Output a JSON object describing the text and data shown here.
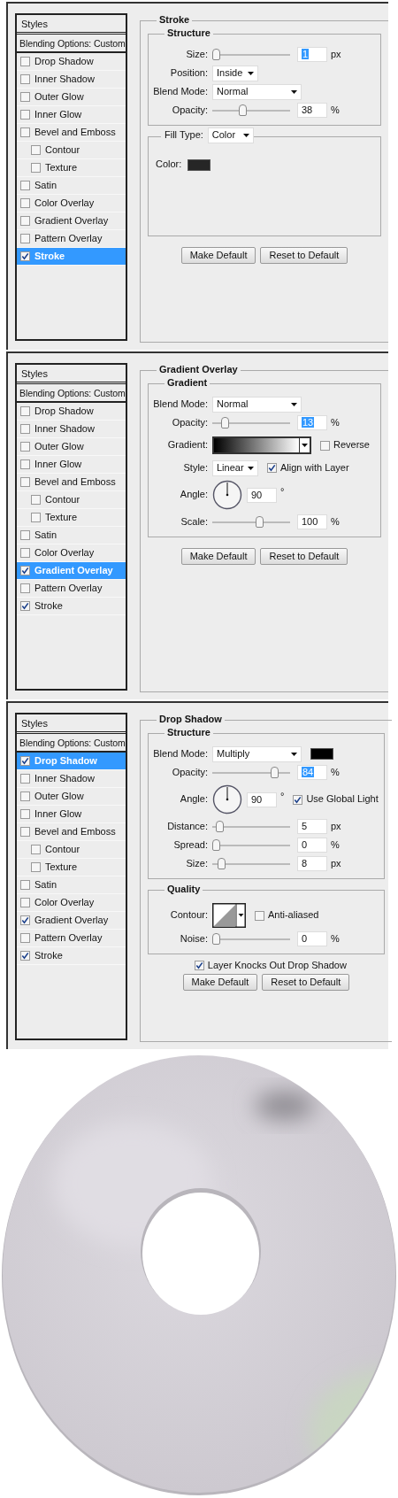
{
  "panels": [
    {
      "header": "Styles",
      "blending": "Blending Options: Custom",
      "effects": [
        {
          "label": "Drop Shadow",
          "checked": false,
          "selected": false
        },
        {
          "label": "Inner Shadow",
          "checked": false,
          "selected": false
        },
        {
          "label": "Outer Glow",
          "checked": false,
          "selected": false
        },
        {
          "label": "Inner Glow",
          "checked": false,
          "selected": false
        },
        {
          "label": "Bevel and Emboss",
          "checked": false,
          "selected": false,
          "children": [
            {
              "label": "Contour",
              "checked": false,
              "selected": false
            },
            {
              "label": "Texture",
              "checked": false,
              "selected": false
            }
          ]
        },
        {
          "label": "Satin",
          "checked": false,
          "selected": false
        },
        {
          "label": "Color Overlay",
          "checked": false,
          "selected": false
        },
        {
          "label": "Gradient Overlay",
          "checked": false,
          "selected": false
        },
        {
          "label": "Pattern Overlay",
          "checked": false,
          "selected": false
        },
        {
          "label": "Stroke",
          "checked": true,
          "selected": true
        }
      ],
      "title": "Stroke",
      "groups": [
        {
          "title": "Structure",
          "rows": [
            {
              "kind": "slider",
              "label": "Size:",
              "level": 0,
              "value": "1",
              "unit": "px",
              "highlighted": true
            },
            {
              "kind": "select",
              "label": "Position:",
              "value": "Inside",
              "wide": false
            },
            {
              "kind": "select",
              "label": "Blend Mode:",
              "value": "Normal",
              "wide": true
            },
            {
              "kind": "slider",
              "label": "Opacity:",
              "level": 0.38,
              "value": "38",
              "unit": "%",
              "highlighted": false
            }
          ]
        },
        {
          "legend": {
            "label": "Fill Type:",
            "value": "Color"
          },
          "rows": [
            {
              "kind": "color",
              "label": "Color:",
              "color": "#262626"
            }
          ]
        }
      ],
      "buttons": [
        "Make Default",
        "Reset to Default"
      ]
    },
    {
      "header": "Styles",
      "blending": "Blending Options: Custom",
      "effects": [
        {
          "label": "Drop Shadow",
          "checked": false,
          "selected": false
        },
        {
          "label": "Inner Shadow",
          "checked": false,
          "selected": false
        },
        {
          "label": "Outer Glow",
          "checked": false,
          "selected": false
        },
        {
          "label": "Inner Glow",
          "checked": false,
          "selected": false
        },
        {
          "label": "Bevel and Emboss",
          "checked": false,
          "selected": false,
          "children": [
            {
              "label": "Contour",
              "checked": false,
              "selected": false
            },
            {
              "label": "Texture",
              "checked": false,
              "selected": false
            }
          ]
        },
        {
          "label": "Satin",
          "checked": false,
          "selected": false
        },
        {
          "label": "Color Overlay",
          "checked": false,
          "selected": false
        },
        {
          "label": "Gradient Overlay",
          "checked": true,
          "selected": true
        },
        {
          "label": "Pattern Overlay",
          "checked": false,
          "selected": false
        },
        {
          "label": "Stroke",
          "checked": true,
          "selected": false
        }
      ],
      "title": "Gradient Overlay",
      "groups": [
        {
          "title": "Gradient",
          "rows": [
            {
              "kind": "select",
              "label": "Blend Mode:",
              "value": "Normal",
              "wide": true
            },
            {
              "kind": "slider",
              "label": "Opacity:",
              "level": 0.13,
              "value": "13",
              "unit": "%",
              "highlighted": true
            },
            {
              "kind": "gradient",
              "label": "Gradient:",
              "check": {
                "label": "Reverse",
                "checked": false
              }
            },
            {
              "kind": "select",
              "label": "Style:",
              "value": "Linear",
              "wide": false,
              "check": {
                "label": "Align with Layer",
                "checked": true
              }
            },
            {
              "kind": "angle",
              "label": "Angle:",
              "value": "90",
              "unit": "°"
            },
            {
              "kind": "slider",
              "label": "Scale:",
              "level": 0.62,
              "value": "100",
              "unit": "%",
              "highlighted": false
            }
          ]
        }
      ],
      "buttons": [
        "Make Default",
        "Reset to Default"
      ]
    },
    {
      "header": "Styles",
      "blending": "Blending Options: Custom",
      "effects": [
        {
          "label": "Drop Shadow",
          "checked": true,
          "selected": true
        },
        {
          "label": "Inner Shadow",
          "checked": false,
          "selected": false
        },
        {
          "label": "Outer Glow",
          "checked": false,
          "selected": false
        },
        {
          "label": "Inner Glow",
          "checked": false,
          "selected": false
        },
        {
          "label": "Bevel and Emboss",
          "checked": false,
          "selected": false,
          "children": [
            {
              "label": "Contour",
              "checked": false,
              "selected": false
            },
            {
              "label": "Texture",
              "checked": false,
              "selected": false
            }
          ]
        },
        {
          "label": "Satin",
          "checked": false,
          "selected": false
        },
        {
          "label": "Color Overlay",
          "checked": false,
          "selected": false
        },
        {
          "label": "Gradient Overlay",
          "checked": true,
          "selected": false
        },
        {
          "label": "Pattern Overlay",
          "checked": false,
          "selected": false
        },
        {
          "label": "Stroke",
          "checked": true,
          "selected": false
        }
      ],
      "title": "Drop Shadow",
      "groups": [
        {
          "title": "Structure",
          "rows": [
            {
              "kind": "select",
              "label": "Blend Mode:",
              "value": "Multiply",
              "wide": true,
              "color": "#000000"
            },
            {
              "kind": "slider",
              "label": "Opacity:",
              "level": 0.84,
              "value": "84",
              "unit": "%",
              "highlighted": true
            },
            {
              "kind": "angle",
              "label": "Angle:",
              "value": "90",
              "unit": "°",
              "check": {
                "label": "Use Global Light",
                "checked": true
              }
            },
            {
              "kind": "slider",
              "label": "Distance:",
              "level": 0.05,
              "value": "5",
              "unit": "px",
              "highlighted": false
            },
            {
              "kind": "slider",
              "label": "Spread:",
              "level": 0,
              "value": "0",
              "unit": "%",
              "highlighted": false
            },
            {
              "kind": "slider",
              "label": "Size:",
              "level": 0.08,
              "value": "8",
              "unit": "px",
              "highlighted": false
            }
          ]
        },
        {
          "title": "Quality",
          "rows": [
            {
              "kind": "contour",
              "label": "Contour:",
              "check": {
                "label": "Anti-aliased",
                "checked": false
              }
            },
            {
              "kind": "slider",
              "label": "Noise:",
              "level": 0,
              "value": "0",
              "unit": "%",
              "highlighted": false
            }
          ]
        }
      ],
      "footer_check": {
        "label": "Layer Knocks Out Drop Shadow",
        "checked": true
      },
      "buttons": [
        "Make Default",
        "Reset to Default"
      ]
    }
  ]
}
